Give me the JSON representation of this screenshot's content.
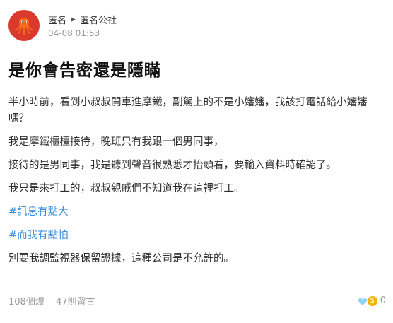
{
  "post": {
    "author": "匿名",
    "board": "匿名公社",
    "time": "04-08 01:53",
    "title": "是你會告密還是隱瞞",
    "paragraphs": [
      "半小時前，看到小叔叔開車進摩鐵，副駕上的不是小嬸嬸，我該打電話給小嬸嬸嗎？",
      "我是摩鐵櫃檯接待，晚班只有我跟一個男同事，",
      "接待的是男同事，我是聽到聲音很熟悉才抬頭看，要輸入資料時確認了。",
      "我只是來打工的，叔叔親戚們不知道我在這裡打工。"
    ],
    "tags": [
      "#訊息有點大",
      "#而我有點怕"
    ],
    "last_paragraph": "別要我調監視器保留證據，這種公司是不允許的。",
    "views": "108個爆",
    "comments": "47則留言",
    "reaction_count": "0",
    "coin_symbol": "$"
  }
}
